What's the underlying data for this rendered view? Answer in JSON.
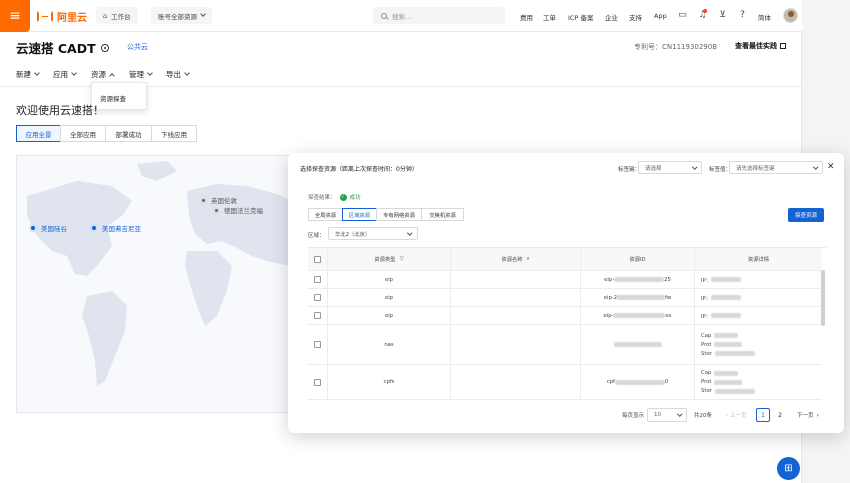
{
  "topbar": {
    "brand": "阿里云",
    "workbench": "工作台",
    "account_scope": "账号全部资源",
    "search_placeholder": "搜索...",
    "links": [
      "费用",
      "工单",
      "ICP 备案",
      "企业",
      "支持",
      "App"
    ],
    "language": "简体"
  },
  "header": {
    "title": "云速搭 CADT",
    "cloud_type": "公共云",
    "patent": "专利号：CN111930290B",
    "best_practice": "查看最佳实践"
  },
  "nav": {
    "items": [
      "新建",
      "应用",
      "资源",
      "管理",
      "导出"
    ],
    "dropdown_item": "资源探查"
  },
  "welcome": "欢迎使用云速搭！",
  "segments": [
    "应用全景",
    "全部应用",
    "部署成功",
    "下线应用"
  ],
  "map": {
    "labels": [
      "美国硅谷",
      "美国弗吉尼亚",
      "英国伦敦",
      "德国法兰克福"
    ]
  },
  "modal": {
    "title": "选择探查资源（距离上次探查时间：0分钟）",
    "tag_key_label": "标签键：",
    "tag_key_placeholder": "请选择",
    "tag_value_label": "标签值：",
    "tag_value_placeholder": "请先选择标签键",
    "scan_result_label": "探查结果：",
    "scan_result_value": "成功",
    "tabs": [
      "全局资源",
      "区域资源",
      "专有网络资源",
      "交换机资源"
    ],
    "scan_button": "探查资源",
    "region_label": "区域：",
    "region_value": "华北2（北京）",
    "table": {
      "headers": [
        "资源类型",
        "资源名称",
        "资源ID",
        "资源详情"
      ],
      "rows": [
        {
          "type": "eip",
          "id_prefix": "eip-",
          "id_suffix": "25",
          "details": [
            "IP："
          ]
        },
        {
          "type": "eip",
          "id_prefix": "eip-2",
          "id_suffix": "fw",
          "details": [
            "IP："
          ]
        },
        {
          "type": "eip",
          "id_prefix": "eip-",
          "id_suffix": "es",
          "details": [
            "IP："
          ]
        },
        {
          "type": "nas",
          "id_prefix": "",
          "id_suffix": "",
          "details": [
            "Cap",
            "Prot",
            "Stor"
          ]
        },
        {
          "type": "cpfs",
          "id_prefix": "cpf",
          "id_suffix": "0",
          "details": [
            "Cap",
            "Prot",
            "Stor"
          ]
        }
      ]
    },
    "pagination": {
      "page_size_label": "每页显示",
      "page_size": "10",
      "total": "共20条",
      "prev": "上一页",
      "pages": [
        "1",
        "2"
      ],
      "next": "下一页"
    }
  }
}
